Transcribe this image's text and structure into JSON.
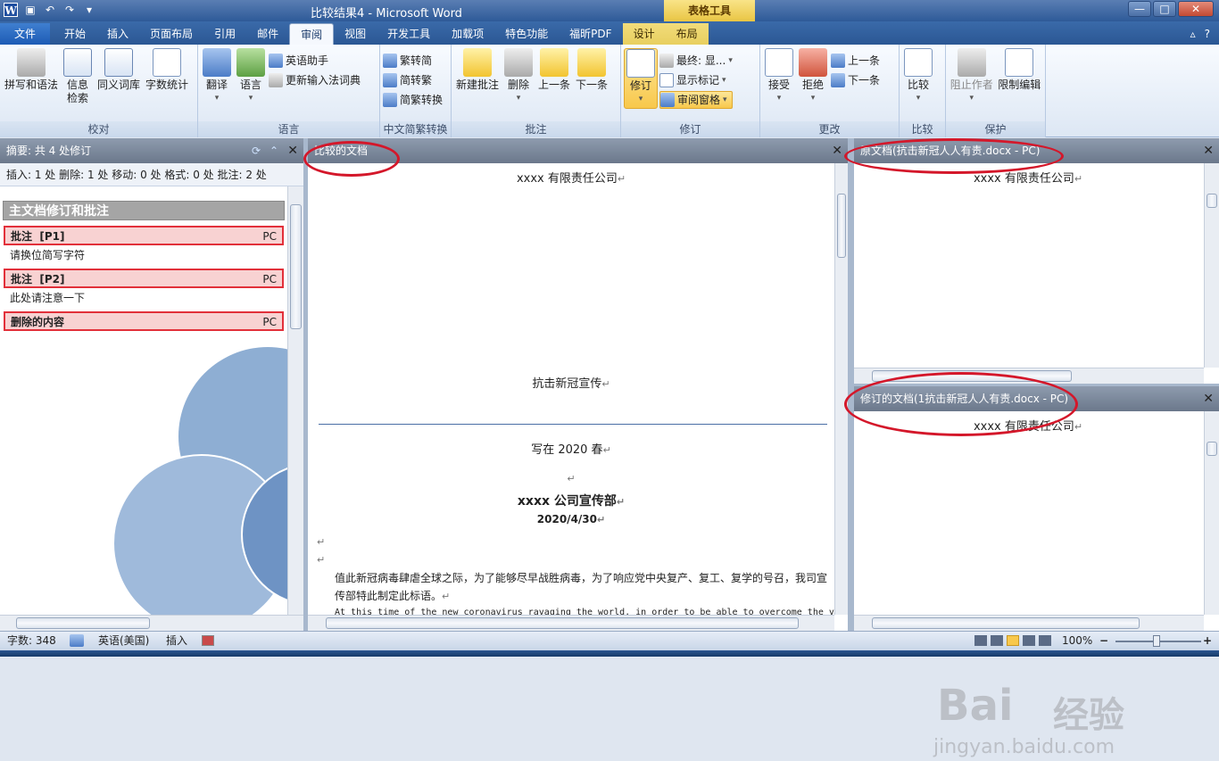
{
  "window": {
    "title": "比较结果4 - Microsoft Word",
    "context_tab_group": "表格工具",
    "controls": {
      "minimize": "—",
      "maximize": "□",
      "close": "✕"
    }
  },
  "qat": {
    "app_icon": "W",
    "save": "▣",
    "undo": "↶",
    "redo": "↷",
    "more": "▾"
  },
  "tabs": [
    {
      "label": "文件",
      "kind": "file"
    },
    {
      "label": "开始"
    },
    {
      "label": "插入"
    },
    {
      "label": "页面布局"
    },
    {
      "label": "引用"
    },
    {
      "label": "邮件"
    },
    {
      "label": "审阅",
      "active": true
    },
    {
      "label": "视图"
    },
    {
      "label": "开发工具"
    },
    {
      "label": "加载项"
    },
    {
      "label": "特色功能"
    },
    {
      "label": "福昕PDF"
    },
    {
      "label": "设计",
      "context": true
    },
    {
      "label": "布局",
      "context": true
    }
  ],
  "tab_right": {
    "collapse": "▵",
    "help": "?"
  },
  "ribbon": {
    "proofing": {
      "label": "校对",
      "spell": "拼写和语法",
      "research_1": "信息",
      "research_2": "检索",
      "thesaurus": "同义词库",
      "wordcount": "字数统计"
    },
    "language": {
      "label": "语言",
      "translate": "翻译",
      "language": "语言",
      "english_assistant": "英语助手",
      "update_ime": "更新输入法词典"
    },
    "chinese_conv": {
      "label": "中文简繁转换",
      "to_simplified": "繁转简",
      "to_traditional": "简转繁",
      "convert": "简繁转换"
    },
    "comments": {
      "label": "批注",
      "new": "新建批注",
      "delete": "删除",
      "prev": "上一条",
      "next": "下一条"
    },
    "tracking": {
      "label": "修订",
      "track": "修订",
      "final": "最终: 显...",
      "show_markup": "显示标记",
      "review_pane": "审阅窗格"
    },
    "changes": {
      "label": "更改",
      "accept": "接受",
      "reject": "拒绝",
      "prev": "上一条",
      "next": "下一条"
    },
    "compare": {
      "label": "比较",
      "compare": "比较"
    },
    "protect": {
      "label": "保护",
      "block_authors": "阻止作者",
      "restrict": "限制编辑"
    }
  },
  "left_pane": {
    "header": "摘要: 共 4 处修订",
    "summary": "插入: 1 处 删除: 1 处 移动: 0 处 格式: 0 处 批注: 2 处",
    "section_title": "主文档修订和批注",
    "items": [
      {
        "type": "批注",
        "ref": "[P1]",
        "author": "PC",
        "text": "请换位简写字符"
      },
      {
        "type": "批注",
        "ref": "[P2]",
        "author": "PC",
        "text": "此处请注意一下"
      },
      {
        "type": "删除的内容",
        "ref": "",
        "author": "PC",
        "text": ""
      }
    ]
  },
  "mid_pane": {
    "header": "比较的文档",
    "lines": {
      "company": "xxxx 有限责任公司",
      "title": "抗击新冠宣传",
      "written": "写在 2020 春",
      "dept": "xxxx 公司宣传部",
      "date": "2020/4/30",
      "para1a": "值此新冠病毒肆虐全球之际，为了能够尽早战胜病毒，为了响应党中央复产、复工、复学的号召，我司宣",
      "para1b": "传部特此制定此标语。",
      "para2": "At this time of the new coronavirus ravaging the world, in order to be able to overcome the virus"
    },
    "mark": "↵"
  },
  "right_top": {
    "header": "原文档(抗击新冠人人有责.docx - PC)",
    "line1": "xxxx 有限责任公司"
  },
  "right_bot": {
    "header": "修订的文档(1抗击新冠人人有责.docx - PC)",
    "line1": "xxxx 有限责任公司"
  },
  "status": {
    "words": "字数: 348",
    "lang": "英语(美国)",
    "mode": "插入",
    "zoom": "100%",
    "zoom_out": "−",
    "zoom_in": "+"
  },
  "watermark": {
    "brand": "Bai",
    "brand2": "经验",
    "url": "jingyan.baidu.com"
  },
  "colors": {
    "annotation": "#d4172a",
    "tab_bar": "#2b5794",
    "ribbon": "#dde7f4"
  }
}
